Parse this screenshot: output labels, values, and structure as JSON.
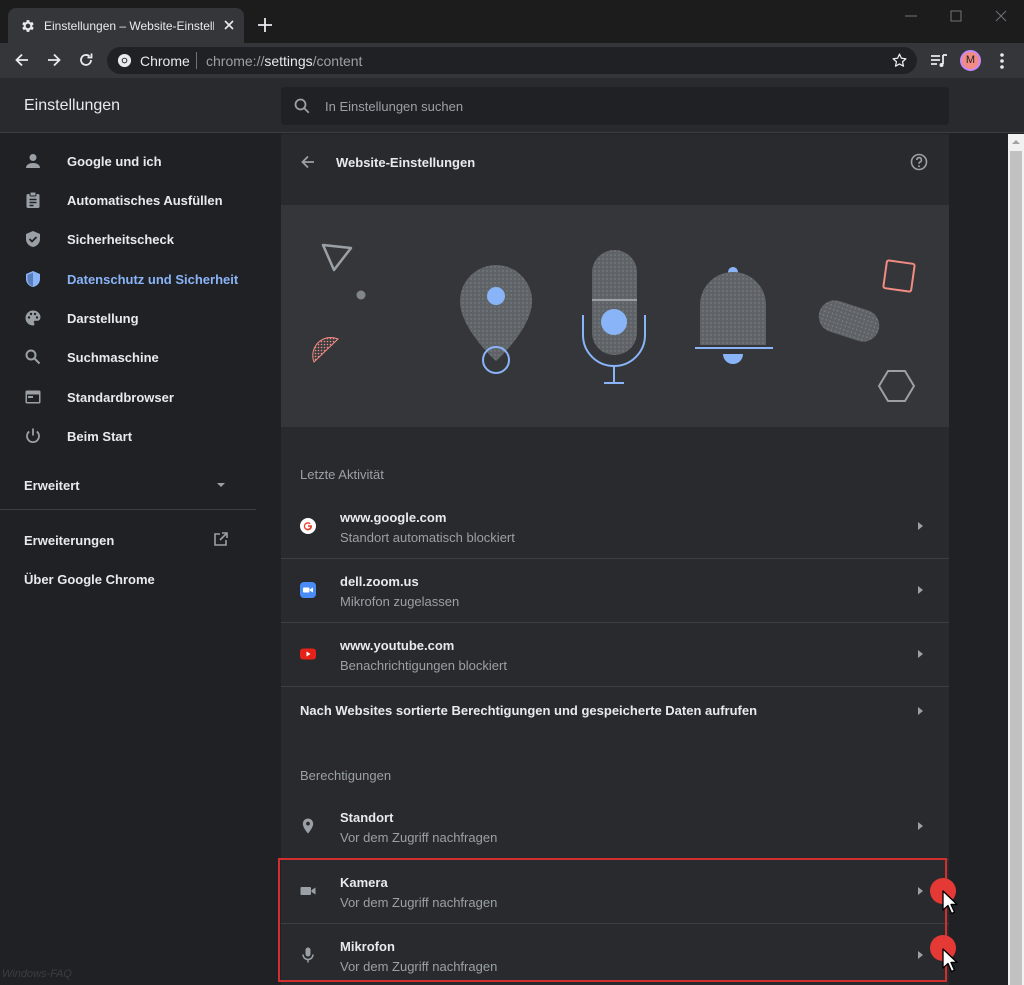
{
  "browser": {
    "tab_title": "Einstellungen – Website-Einstellu",
    "omnibox_site": "Chrome",
    "url_prefix": "chrome://",
    "url_highlight": "settings",
    "url_suffix": "/content",
    "profile_initial": "M"
  },
  "header": {
    "title": "Einstellungen",
    "search_placeholder": "In Einstellungen suchen"
  },
  "sidebar": {
    "items": [
      {
        "label": "Google und ich",
        "icon": "person-icon"
      },
      {
        "label": "Automatisches Ausfüllen",
        "icon": "clipboard-icon"
      },
      {
        "label": "Sicherheitscheck",
        "icon": "shield-check-icon"
      },
      {
        "label": "Datenschutz und Sicherheit",
        "icon": "shield-icon",
        "active": true
      },
      {
        "label": "Darstellung",
        "icon": "palette-icon"
      },
      {
        "label": "Suchmaschine",
        "icon": "search-icon"
      },
      {
        "label": "Standardbrowser",
        "icon": "browser-icon"
      },
      {
        "label": "Beim Start",
        "icon": "power-icon"
      }
    ],
    "advanced_label": "Erweitert",
    "extensions_label": "Erweiterungen",
    "about_label": "Über Google Chrome"
  },
  "main": {
    "title": "Website-Einstellungen",
    "recent_title": "Letzte Aktivität",
    "recent": [
      {
        "site": "www.google.com",
        "status": "Standort automatisch blockiert",
        "icon": "google-favicon"
      },
      {
        "site": "dell.zoom.us",
        "status": "Mikrofon zugelassen",
        "icon": "zoom-favicon"
      },
      {
        "site": "www.youtube.com",
        "status": "Benachrichtigungen blockiert",
        "icon": "youtube-favicon"
      }
    ],
    "all_sites_label": "Nach Websites sortierte Berechtigungen und gespeicherte Daten aufrufen",
    "permissions_title": "Berechtigungen",
    "permissions": [
      {
        "name": "Standort",
        "status": "Vor dem Zugriff nachfragen",
        "icon": "location-pin-icon"
      },
      {
        "name": "Kamera",
        "status": "Vor dem Zugriff nachfragen",
        "icon": "camera-icon"
      },
      {
        "name": "Mikrofon",
        "status": "Vor dem Zugriff nachfragen",
        "icon": "microphone-icon"
      }
    ]
  },
  "watermark": "Windows-FAQ",
  "colors": {
    "accent": "#8ab4f8",
    "highlight_border": "#d32f2f",
    "click_marker": "#e53935"
  }
}
